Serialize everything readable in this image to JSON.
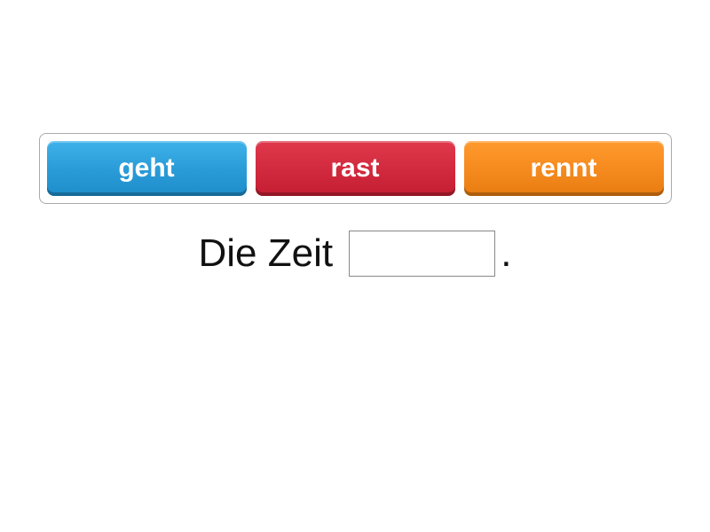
{
  "options": [
    {
      "label": "geht",
      "color": "blue"
    },
    {
      "label": "rast",
      "color": "red"
    },
    {
      "label": "rennt",
      "color": "orange"
    }
  ],
  "sentence": {
    "before": "Die Zeit ",
    "after": "."
  },
  "colors": {
    "blue": "#2a9cd8",
    "red": "#d22a3e",
    "orange": "#f68b1f"
  }
}
